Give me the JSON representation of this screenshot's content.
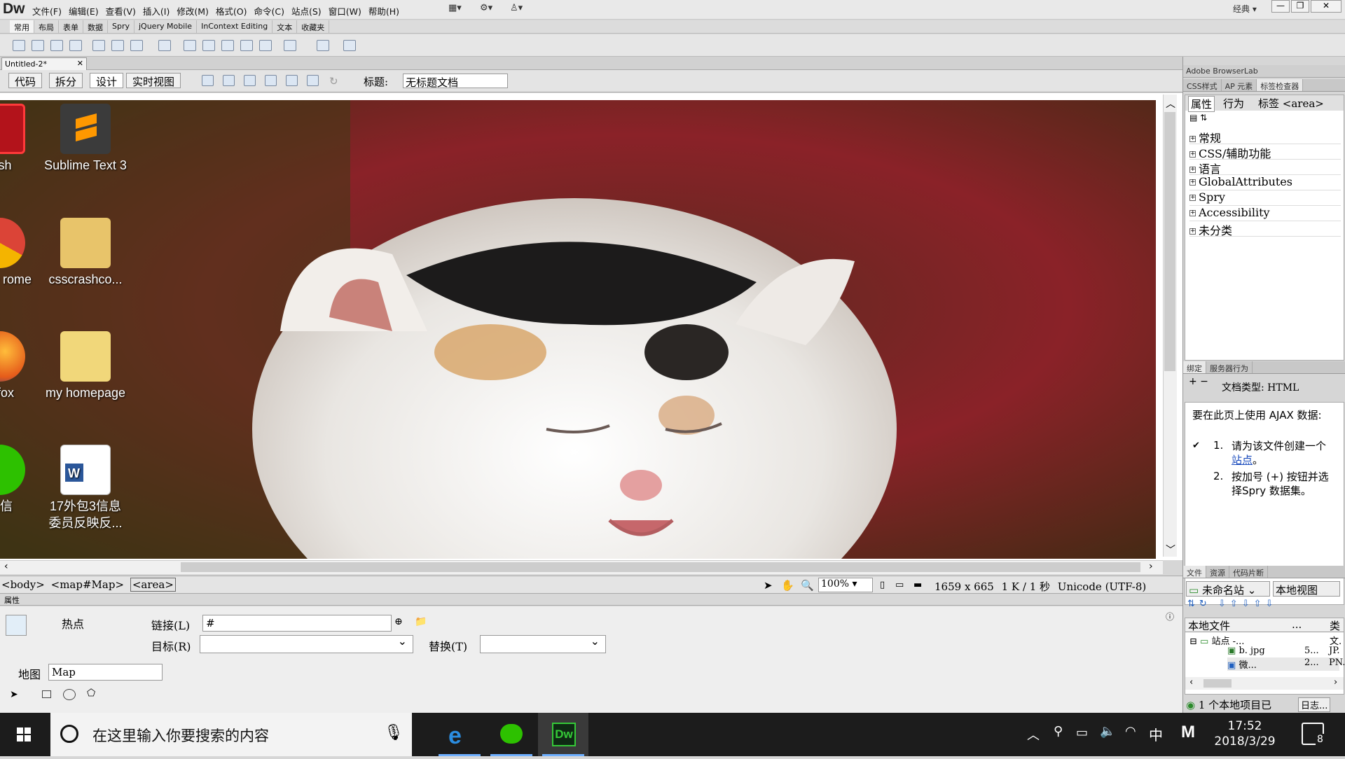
{
  "app": {
    "logo": "Dw",
    "menus": [
      "文件(F)",
      "编辑(E)",
      "查看(V)",
      "插入(I)",
      "修改(M)",
      "格式(O)",
      "命令(C)",
      "站点(S)",
      "窗口(W)",
      "帮助(H)"
    ],
    "workspace": "经典",
    "window_buttons": [
      "—",
      "❐",
      "✕"
    ]
  },
  "insert_tabs": [
    "常用",
    "布局",
    "表单",
    "数据",
    "Spry",
    "jQuery Mobile",
    "InContext Editing",
    "文本",
    "收藏夹"
  ],
  "document": {
    "tab_label": "Untitled-2*",
    "views": [
      "代码",
      "拆分",
      "设计",
      "实时视图"
    ],
    "title_label": "标题:",
    "title_value": "无标题文档"
  },
  "desktop_icons": [
    {
      "label": "lash",
      "icon": "flash-icon"
    },
    {
      "label": "Sublime Text 3",
      "icon": "sublime-icon"
    },
    {
      "label": "oogle rome",
      "icon": "chrome-icon"
    },
    {
      "label": "csscrashco...",
      "icon": "folder-icon"
    },
    {
      "label": "refox",
      "icon": "firefox-icon"
    },
    {
      "label": "my homepage",
      "icon": "folder-icon"
    },
    {
      "label": "微信",
      "icon": "wechat-icon"
    },
    {
      "label": "17外包3信息委员反映反...",
      "icon": "word-doc-icon"
    }
  ],
  "status": {
    "tags": [
      "<body>",
      "<map#Map>",
      "<area>"
    ],
    "zoom": "100%",
    "dimensions": "1659 x 665",
    "size": "1 K / 1 秒",
    "encoding": "Unicode (UTF-8)"
  },
  "properties": {
    "header": "属性",
    "hotspot_label": "热点",
    "link_label": "链接(L)",
    "link_value": "#",
    "target_label": "目标(R)",
    "alt_label": "替换(T)",
    "map_label": "地图",
    "map_value": "Map"
  },
  "right_panel": {
    "browserlab": "Adobe BrowserLab",
    "tag_tabs": [
      "CSS样式",
      "AP 元素",
      "标签检查器"
    ],
    "subtabs": [
      "属性",
      "行为",
      "标签 <area>"
    ],
    "categories": [
      "常规",
      "CSS/辅助功能",
      "语言",
      "GlobalAttributes",
      "Spry",
      "Accessibility",
      "未分类"
    ],
    "bind_tabs": [
      "绑定",
      "服务器行为"
    ],
    "doc_type": "文档类型: HTML",
    "ajax_intro": "要在此页上使用 AJAX 数据:",
    "step1_prefix": "请为该文件创建一个",
    "step1_link": "站点",
    "step1_suffix": "。",
    "step2": "按加号 (+) 按钮并选择Spry 数据集。",
    "files_tabs": [
      "文件",
      "资源",
      "代码片断"
    ],
    "site_name": "未命名站",
    "view_name": "本地视图",
    "col_local": "本地文件",
    "col_type": "类",
    "tree": [
      {
        "name": "站点 -...",
        "type": "文."
      },
      {
        "name": "b. jpg",
        "size": "5...",
        "type": "JP."
      },
      {
        "name": "微...",
        "size": "2...",
        "type": "PN."
      }
    ],
    "footer": "1 个本地项目已",
    "footer_btn": "日志..."
  },
  "taskbar": {
    "search_placeholder": "在这里输入你要搜索的内容",
    "time": "17:52",
    "date": "2018/3/29",
    "ime": "中",
    "notifications": "8"
  }
}
